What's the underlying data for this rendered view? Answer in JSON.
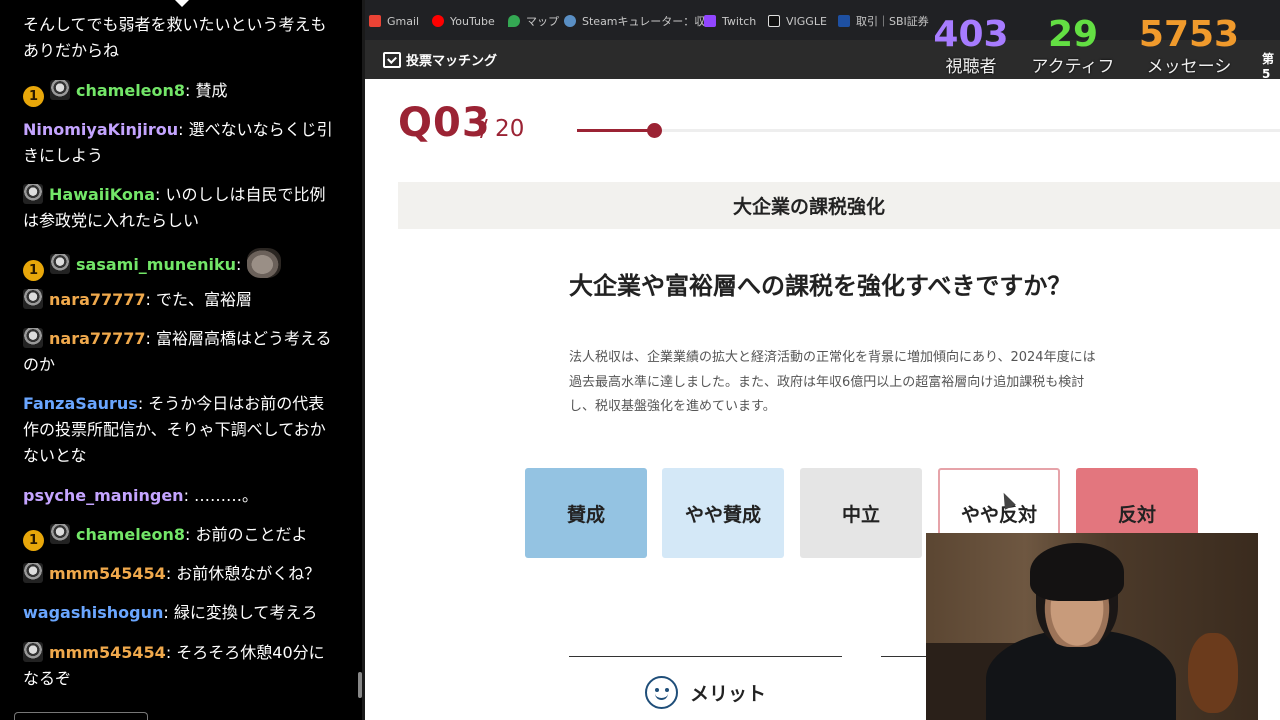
{
  "chat": {
    "messages": [
      {
        "text_line": "そんしてでも弱者を救いたいという考えもありだからね"
      },
      {
        "badge": "1",
        "user": "chameleon8",
        "text": ": 賛成"
      },
      {
        "user": "NinomiyaKinjirou",
        "text": ": 選べないならくじ引きにしよう"
      },
      {
        "user": "HawaiiKona",
        "text": ": いのししは自民で比例は参政党に入れたらしい"
      },
      {
        "badge": "1",
        "user": "sasami_muneniku",
        "text": ":"
      },
      {
        "user": "nara77777",
        "text": ": でた、富裕層"
      },
      {
        "user": "nara77777",
        "text": ": 富裕層高橋はどう考えるのか"
      },
      {
        "user": "FanzaSaurus",
        "text": ": そうか今日はお前の代表作の投票所配信か、そりゃ下調べしておかないとな"
      },
      {
        "user": "psyche_maningen",
        "text": ": ………。"
      },
      {
        "badge": "1",
        "user": "chameleon8",
        "text": ": お前のことだよ"
      },
      {
        "user": "mmm545454",
        "text": ": お前休憩ながくね？"
      },
      {
        "user": "wagashishogun",
        "text": ": 緑に変換して考えろ"
      },
      {
        "user": "mmm545454",
        "text": ": そろそろ休憩40分になるぞ"
      }
    ]
  },
  "bookmarks": [
    {
      "label": "Gmail",
      "icon": "gmail-icon",
      "color": "#ea4335"
    },
    {
      "label": "YouTube",
      "icon": "youtube-icon",
      "color": "#ff0000"
    },
    {
      "label": "マップ",
      "icon": "maps-icon",
      "color": "#34a853"
    },
    {
      "label": "Steamキュレーター：収...",
      "icon": "steam-icon",
      "color": "#5a8fc4"
    },
    {
      "label": "Twitch",
      "icon": "twitch-icon",
      "color": "#9146ff"
    },
    {
      "label": "VIGGLE",
      "icon": "viggle-icon",
      "color": "#ffffff"
    },
    {
      "label": "取引｜SBI証券",
      "icon": "sbi-icon",
      "color": "#1e50a2"
    }
  ],
  "site": {
    "name": "投票マッチング",
    "side_tag": "第5"
  },
  "stats": [
    {
      "value": "403",
      "label": "視聴者",
      "color": "#a77cff"
    },
    {
      "value": "29",
      "label": "アクティフ",
      "color": "#63df43"
    },
    {
      "value": "5753",
      "label": "メッセーシ",
      "color": "#f09a2c"
    }
  ],
  "question": {
    "number": "Q03",
    "total": "/ 20",
    "progress": 0.15,
    "category": "大企業の課税強化",
    "title": "大企業や富裕層への課税を強化すべきですか？",
    "description_lines": [
      "法人税収は、企業業績の拡大と経済活動の正常化を背景に増加傾向にあり、2024年度には",
      "過去最高水準に達しました。また、政府は年収6億円以上の超富裕層向け追加課税も検討",
      "し、税収基盤強化を進めています。"
    ]
  },
  "choices": [
    "賛成",
    "やや賛成",
    "中立",
    "やや反対",
    "反対"
  ],
  "merit": {
    "label": "メリット"
  }
}
